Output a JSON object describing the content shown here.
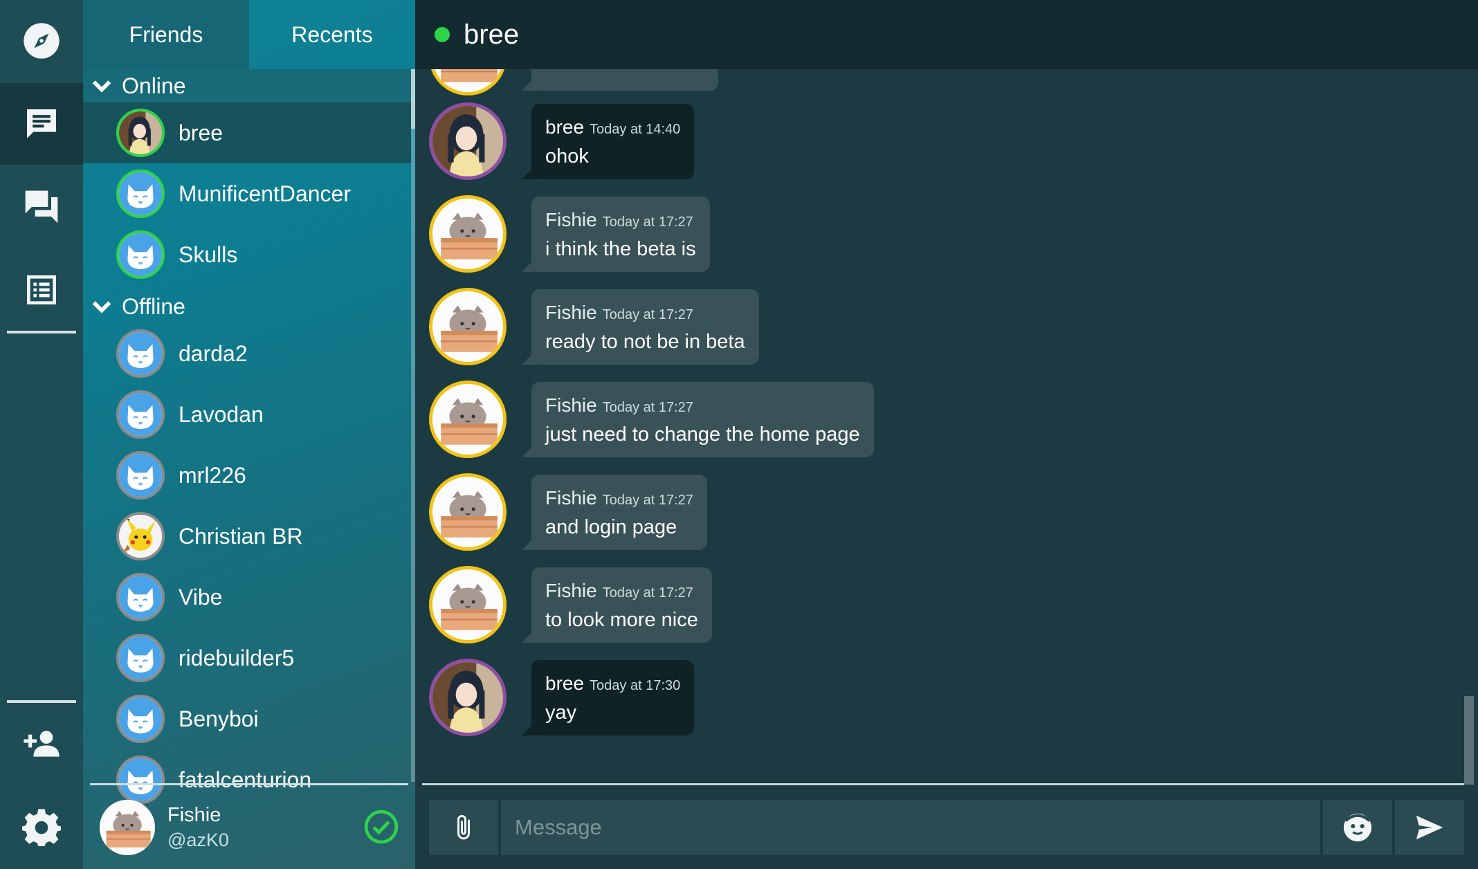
{
  "tabs": {
    "friends": "Friends",
    "recents": "Recents"
  },
  "sections": {
    "online": "Online",
    "offline": "Offline"
  },
  "online_friends": [
    {
      "name": "bree",
      "avatar": "bree-avatar",
      "active": true
    },
    {
      "name": "MunificentDancer",
      "avatar": "cat-avatar"
    },
    {
      "name": "Skulls",
      "avatar": "cat-avatar"
    }
  ],
  "offline_friends": [
    {
      "name": "darda2",
      "avatar": "cat-avatar"
    },
    {
      "name": "Lavodan",
      "avatar": "cat-avatar"
    },
    {
      "name": "mrl226",
      "avatar": "cat-avatar"
    },
    {
      "name": "Christian BR",
      "avatar": "pikachu-avatar"
    },
    {
      "name": "Vibe",
      "avatar": "cat-avatar"
    },
    {
      "name": "ridebuilder5",
      "avatar": "cat-avatar"
    },
    {
      "name": "Benyboi",
      "avatar": "cat-avatar"
    },
    {
      "name": "fatalcenturion",
      "avatar": "cat-avatar"
    }
  ],
  "me": {
    "name": "Fishie",
    "handle": "@azK0",
    "status": "online"
  },
  "chat": {
    "title": "bree",
    "status_color": "#2fd34a",
    "messages": [
      {
        "author": "bree",
        "time": "Today at 14:40",
        "text": "ohok",
        "style": "dark"
      },
      {
        "author": "Fishie",
        "time": "Today at 17:27",
        "text": "i think the beta is",
        "style": "light"
      },
      {
        "author": "Fishie",
        "time": "Today at 17:27",
        "text": "ready to not be in beta",
        "style": "light"
      },
      {
        "author": "Fishie",
        "time": "Today at 17:27",
        "text": "just need to change the home page",
        "style": "light"
      },
      {
        "author": "Fishie",
        "time": "Today at 17:27",
        "text": "and login page",
        "style": "light"
      },
      {
        "author": "Fishie",
        "time": "Today at 17:27",
        "text": "to look more nice",
        "style": "light"
      },
      {
        "author": "bree",
        "time": "Today at 17:30",
        "text": "yay",
        "style": "dark"
      }
    ],
    "input_placeholder": "Message"
  },
  "rail_icons": [
    "compass-icon",
    "chat-bubble-icon",
    "forum-icon",
    "list-icon",
    "add-friend-icon",
    "gear-icon"
  ],
  "colors": {
    "online": "#2fd34a",
    "bree_ring": "#8e4ea3",
    "fishie_ring": "#f2c318"
  }
}
